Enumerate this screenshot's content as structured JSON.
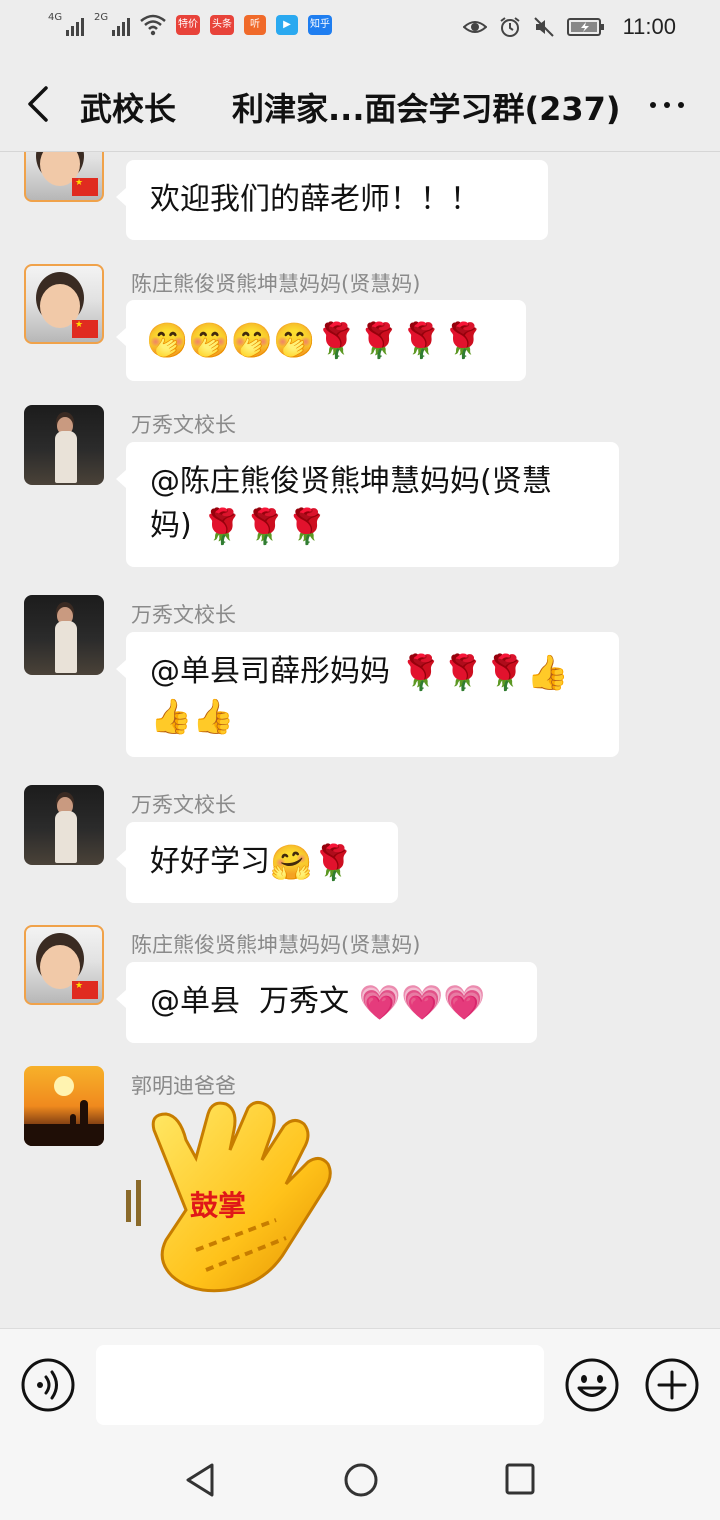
{
  "status_bar": {
    "sim1": "4G",
    "sim2": "2G",
    "badges": [
      {
        "label": "特价",
        "color": "#e8433a"
      },
      {
        "label": "头条",
        "color": "#e8433a"
      },
      {
        "label": "听",
        "color": "#f06a2a"
      },
      {
        "label": "▶",
        "color": "#2aa9f0"
      },
      {
        "label": "知乎",
        "color": "#1f7ef0"
      }
    ],
    "time": "11:00"
  },
  "header": {
    "back_label": "武校长",
    "title": "利津家...面会学习群(237)"
  },
  "messages": [
    {
      "sender": "",
      "avatar": "kid-flag-avatar",
      "text": "欢迎我们的薛老师！！！"
    },
    {
      "sender": "陈庄熊俊贤熊坤慧妈妈(贤慧妈)",
      "avatar": "kid-flag-avatar",
      "emojis": "🤭🤭🤭🤭🌹🌹🌹🌹"
    },
    {
      "sender": "万秀文校长",
      "avatar": "teacher-avatar",
      "line1": "@陈庄熊俊贤熊坤慧妈妈(贤慧",
      "line2_text": "妈)",
      "line2_emojis": "🌹🌹🌹"
    },
    {
      "sender": "万秀文校长",
      "avatar": "teacher-avatar",
      "line1_text": "@单县司薛彤妈妈",
      "line1_emojis": "🌹🌹🌹👍",
      "line2_emojis": "👍👍"
    },
    {
      "sender": "万秀文校长",
      "avatar": "teacher-avatar",
      "text": "好好学习",
      "emojis": "🤗🌹"
    },
    {
      "sender": "陈庄熊俊贤熊坤慧妈妈(贤慧妈)",
      "avatar": "kid-flag-avatar",
      "text": "@单县  万秀文",
      "emojis": "💗💗💗"
    },
    {
      "sender": "郭明迪爸爸",
      "avatar": "sunset-avatar",
      "sticker_text": "鼓掌"
    }
  ],
  "input_bar": {
    "value": "",
    "placeholder": ""
  },
  "icons": {
    "voice": "voice-icon",
    "emoji": "emoji-icon",
    "plus": "plus-icon",
    "back": "chevron-left-icon",
    "more": "more-icon"
  },
  "colors": {
    "background": "#ededed",
    "bubble": "#ffffff",
    "sender_name": "#8a8a8a",
    "sticker_text": "#e01818"
  }
}
